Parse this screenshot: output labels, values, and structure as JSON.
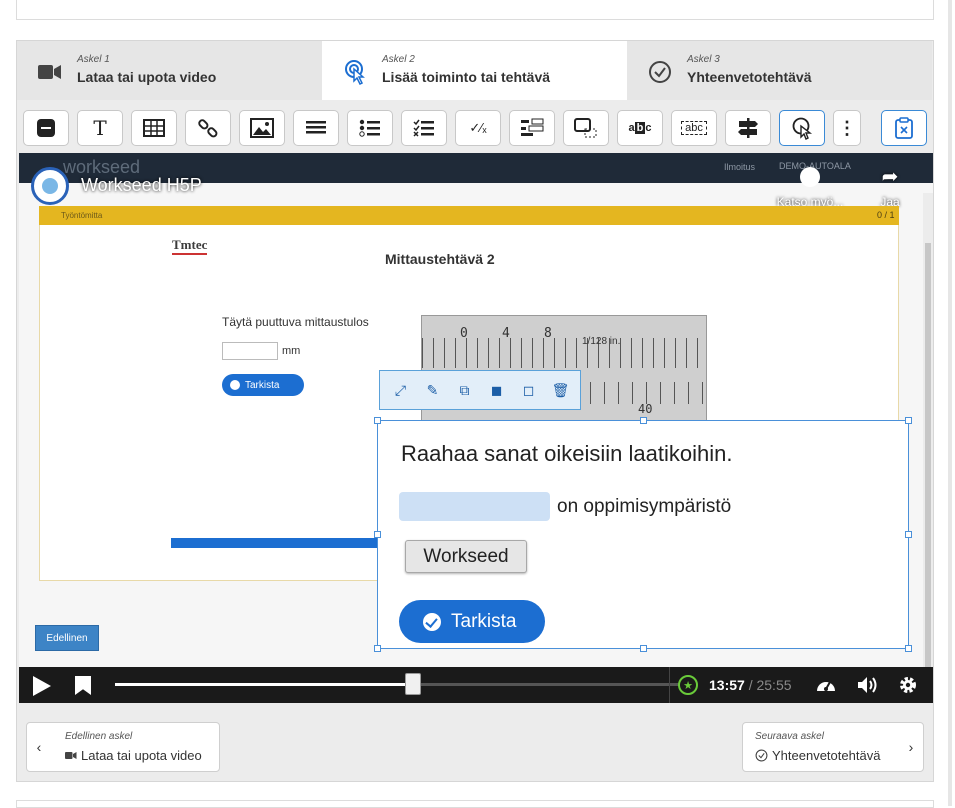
{
  "steps": [
    {
      "num": "Askel 1",
      "title": "Lataa tai upota video",
      "icon": "video-camera-icon",
      "active": false
    },
    {
      "num": "Askel 2",
      "title": "Lisää toiminto tai tehtävä",
      "icon": "hand-pointer-icon",
      "active": true
    },
    {
      "num": "Askel 3",
      "title": "Yhteenvetotehtävä",
      "icon": "check-circle-icon",
      "active": false
    }
  ],
  "toolbar": {
    "buttons": [
      "label",
      "text",
      "table",
      "link",
      "image",
      "statements",
      "single-choice-set",
      "multiple-choice",
      "fill-in-blanks",
      "drag-and-drop",
      "drag-text",
      "mark-the-words",
      "navigation-hotspot",
      "crossroads",
      "more",
      "paste"
    ]
  },
  "video": {
    "title": "Workseed H5P",
    "faded_brand": "workseed",
    "faded_menu": "Ilmoitus",
    "faded_user": "DEMO-AUTOALA",
    "watch_later": "Katso myö...",
    "share": "Jaa",
    "yellow_bar_left": "Työntömitta",
    "yellow_bar_right": "0 / 1",
    "brand_logo": "Tmtec",
    "task_title": "Mittaustehtävä 2",
    "fill_label": "Täytä puuttuva mittaustulos",
    "unit": "mm",
    "small_check": "Tarkista",
    "ruler_nums": [
      "0",
      "4",
      "8"
    ],
    "ruler_fraction": "1/128 in.",
    "ruler_bottom_num": "40",
    "prev_label": "Edellinen"
  },
  "interaction": {
    "question": "Raahaa sanat oikeisiin laatikoihin.",
    "sentence_rest": "on oppimisympäristö",
    "draggable_word": "Workseed",
    "check_label": "Tarkista"
  },
  "player": {
    "current_time": "13:57",
    "separator": "/",
    "total_time": "25:55",
    "progress": 0.5365
  },
  "nav": {
    "prev_caption": "Edellinen askel",
    "prev_label": "Lataa tai upota video",
    "next_caption": "Seuraava askel",
    "next_label": "Yhteenvetotehtävä"
  },
  "colors": {
    "accent": "#1c6ed1",
    "selection": "#4a90d9",
    "drop_zone": "#cde0f5",
    "yellow_bar": "#e4b620"
  }
}
